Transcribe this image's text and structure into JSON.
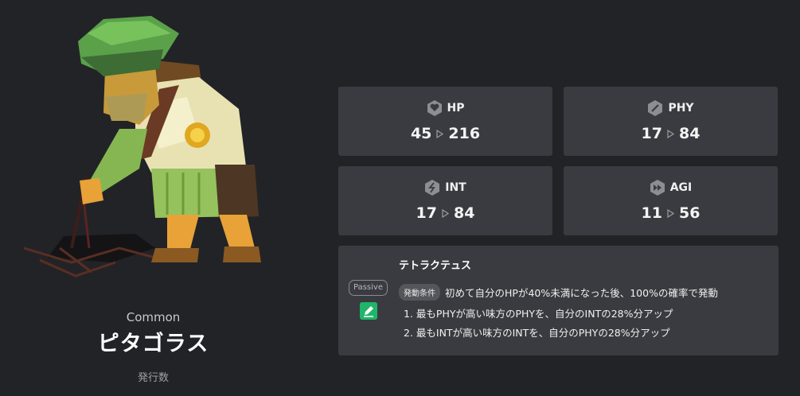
{
  "character": {
    "rarity": "Common",
    "name": "ピタゴラス",
    "issue_label": "発行数",
    "art_icon": "pythagoras-pixel-art"
  },
  "stats": [
    {
      "key": "hp",
      "label": "HP",
      "icon": "heart-icon",
      "base": "45",
      "max": "216"
    },
    {
      "key": "phy",
      "label": "PHY",
      "icon": "sword-icon",
      "base": "17",
      "max": "84"
    },
    {
      "key": "int",
      "label": "INT",
      "icon": "lightning-icon",
      "base": "17",
      "max": "84"
    },
    {
      "key": "agi",
      "label": "AGI",
      "icon": "fast-forward-icon",
      "base": "11",
      "max": "56"
    }
  ],
  "skill": {
    "type_badge": "Passive",
    "icon": "pencil-icon",
    "name": "テトラクテュス",
    "condition_tag": "発動条件",
    "condition_text": "初めて自分のHPが40%未満になった後、100%の確率で発動",
    "effects": [
      "1. 最もPHYが高い味方のPHYを、自分のINTの28%分アップ",
      "2. 最もINTが高い味方のINTを、自分のPHYの28%分アップ"
    ]
  },
  "colors": {
    "background": "#222327",
    "card": "#3a3b40",
    "skill_icon": "#1fb56a"
  }
}
